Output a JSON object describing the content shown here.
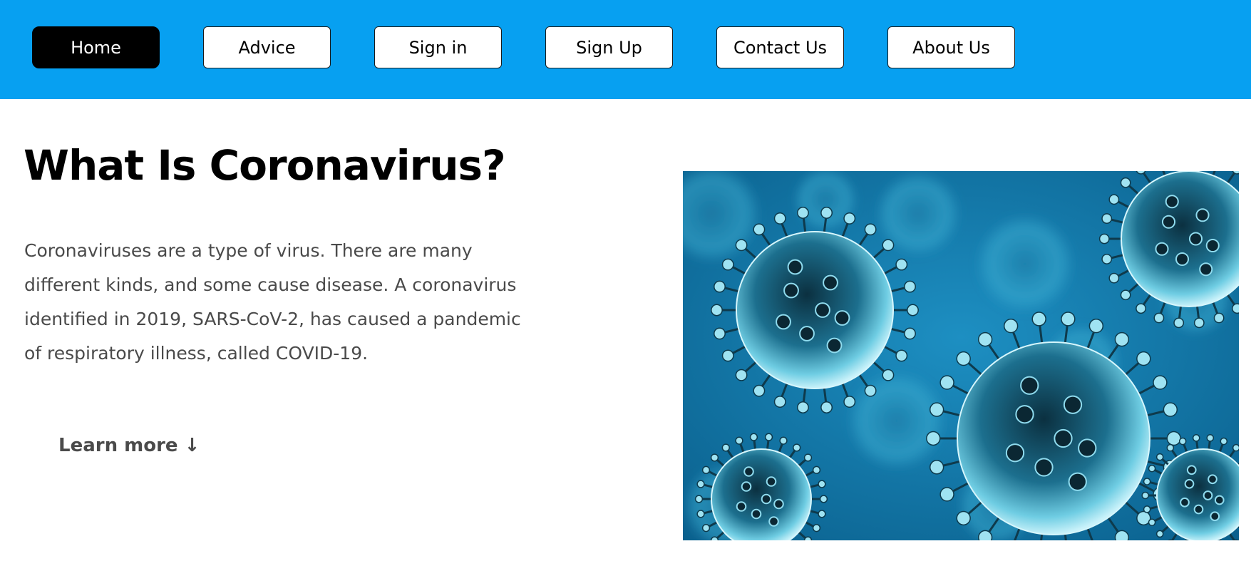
{
  "navbar": {
    "background": "#07a0f1",
    "items": [
      {
        "label": "Home",
        "active": true
      },
      {
        "label": "Advice",
        "active": false
      },
      {
        "label": "Sign in",
        "active": false
      },
      {
        "label": "Sign Up",
        "active": false
      },
      {
        "label": "Contact Us",
        "active": false
      },
      {
        "label": "About Us",
        "active": false
      }
    ]
  },
  "main": {
    "title": "What Is Coronavirus?",
    "intro_lines": [
      "Coronaviruses are a type of virus. There are many",
      "different kinds, and some cause disease. A coronavirus",
      "identified in 2019, SARS-CoV-2, has caused a pandemic",
      "of respiratory illness, called COVID-19."
    ],
    "learn_more": "Learn more ↓"
  },
  "hero_image": {
    "subject": "coronavirus-particles-illustration",
    "colors": {
      "background": "#0a6f9f",
      "particle": "#2f9fc0",
      "particle_light": "#9fe3f2",
      "core": "#0b3040"
    }
  }
}
